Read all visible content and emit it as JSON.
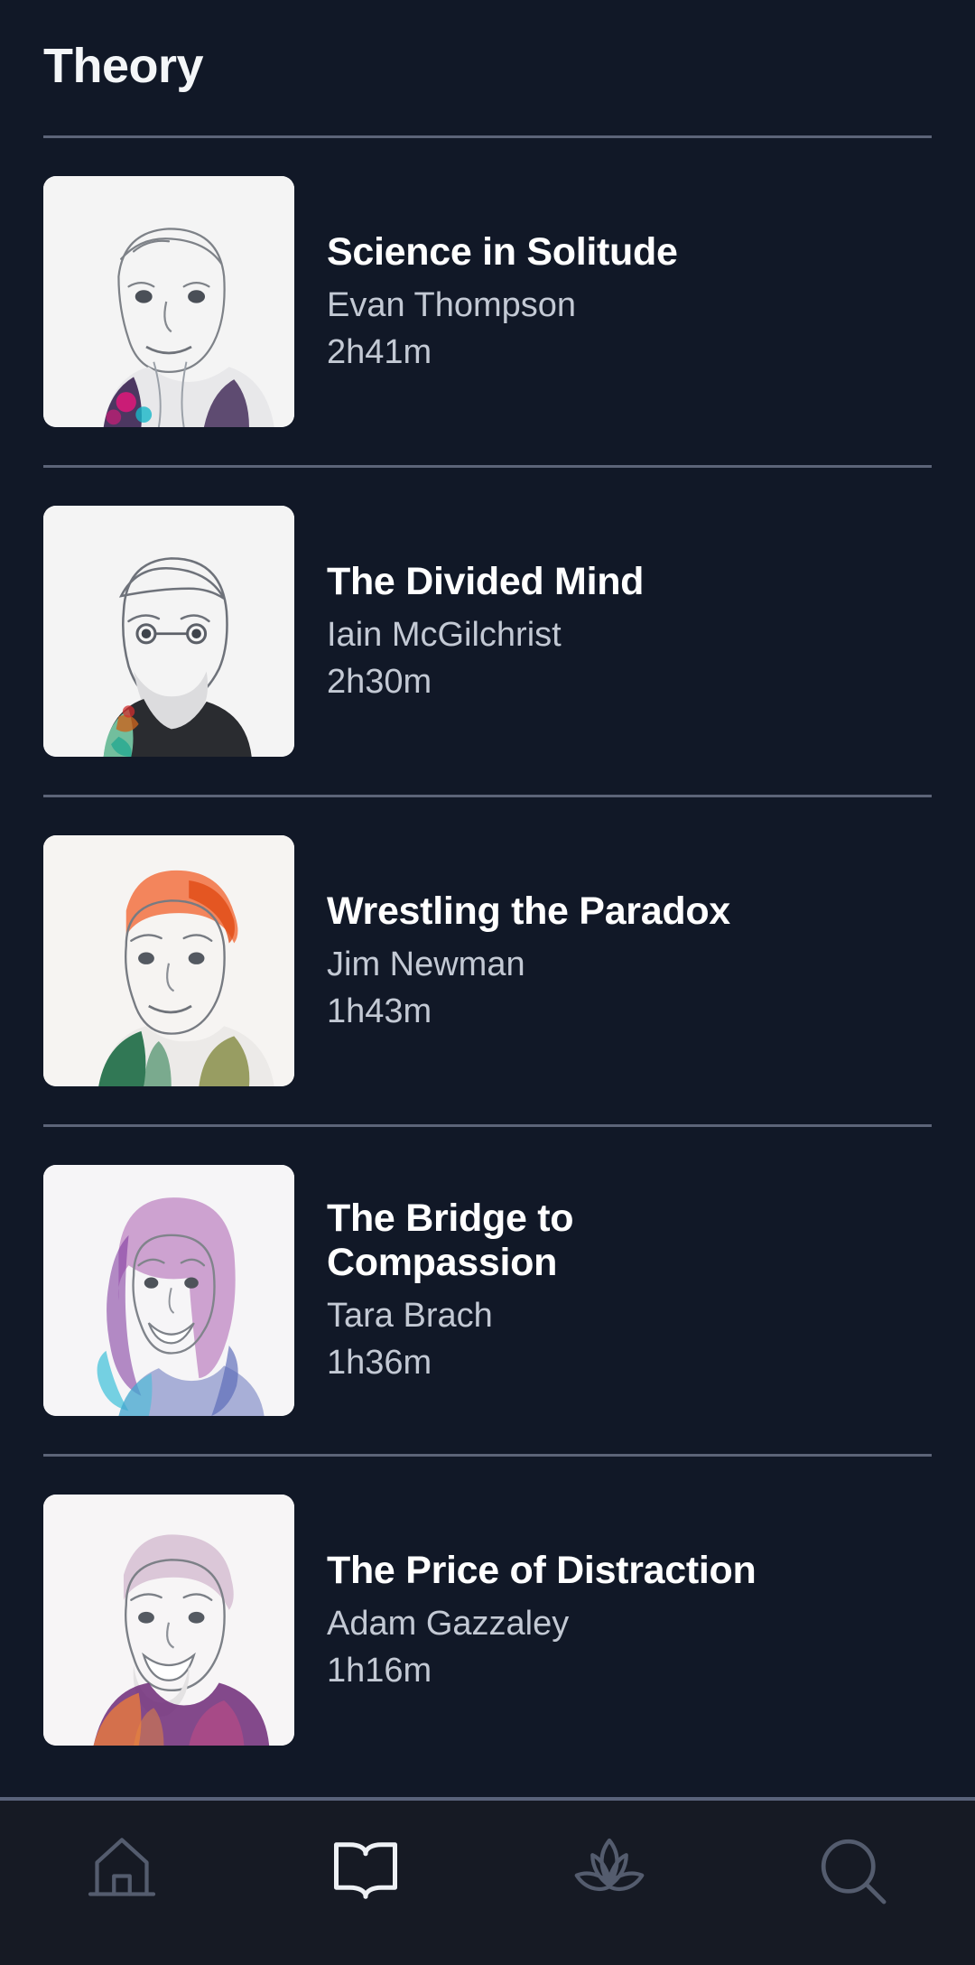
{
  "header": {
    "title": "Theory"
  },
  "list": {
    "items": [
      {
        "title": "Science in Solitude",
        "author": "Evan Thompson",
        "duration": "2h41m",
        "thumb_icon": "portrait-evan-thompson",
        "palette": {
          "a": "#e0187a",
          "b": "#3b2352",
          "c": "#17b6c8"
        }
      },
      {
        "title": "The Divided Mind",
        "author": "Iain McGilchrist",
        "duration": "2h30m",
        "thumb_icon": "portrait-iain-mcgilchrist",
        "palette": {
          "a": "#7fd8b0",
          "b": "#c8641e",
          "c": "#1d1d1f"
        }
      },
      {
        "title": "Wrestling the Paradox",
        "author": "Jim Newman",
        "duration": "1h43m",
        "thumb_icon": "portrait-jim-newman",
        "palette": {
          "a": "#f2602a",
          "b": "#1d6b45",
          "c": "#8a8f4a"
        }
      },
      {
        "title": "The Bridge to Compassion",
        "author": "Tara Brach",
        "duration": "1h36m",
        "thumb_icon": "portrait-tara-brach",
        "palette": {
          "a": "#9c3fa0",
          "b": "#3dc0d8",
          "c": "#4a5ab0"
        }
      },
      {
        "title": "The Price of Distraction",
        "author": "Adam Gazzaley",
        "duration": "1h16m",
        "thumb_icon": "portrait-adam-gazzaley",
        "palette": {
          "a": "#6e2a78",
          "b": "#e87a3c",
          "c": "#c04b86"
        }
      }
    ]
  },
  "tabbar": {
    "tabs": [
      {
        "name": "home",
        "icon": "home-icon",
        "active": false
      },
      {
        "name": "library",
        "icon": "book-icon",
        "active": true
      },
      {
        "name": "practice",
        "icon": "lotus-icon",
        "active": false
      },
      {
        "name": "search",
        "icon": "search-icon",
        "active": false
      }
    ]
  },
  "colors": {
    "background": "#111827",
    "tabbar_background": "#161a24",
    "divider": "#5c6478",
    "title_text": "#ffffff",
    "secondary_text": "#c3c9d4",
    "icon_inactive": "#545c6e",
    "icon_active": "#eef1f5",
    "thumb_background": "#f4f4f4"
  }
}
